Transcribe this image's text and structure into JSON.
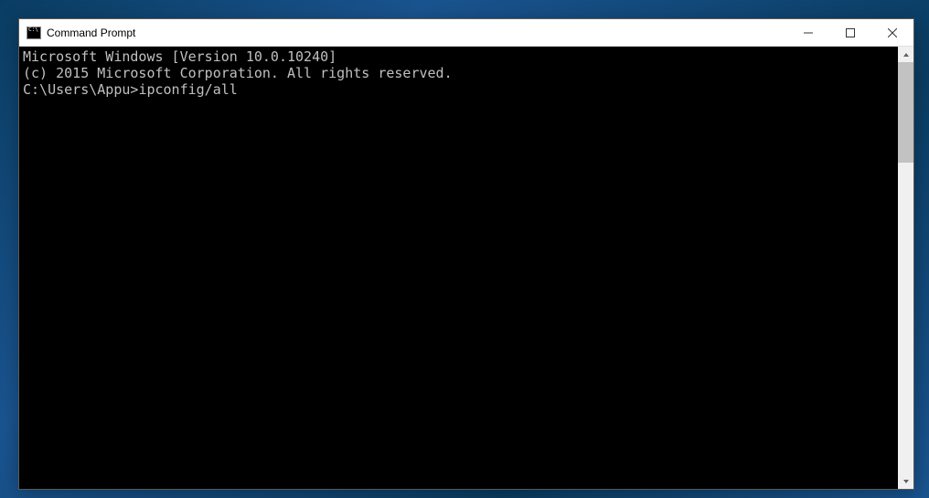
{
  "window": {
    "title": "Command Prompt"
  },
  "terminal": {
    "line1": "Microsoft Windows [Version 10.0.10240]",
    "line2": "(c) 2015 Microsoft Corporation. All rights reserved.",
    "blank": "",
    "prompt": "C:\\Users\\Appu>",
    "command": "ipconfig/all"
  }
}
